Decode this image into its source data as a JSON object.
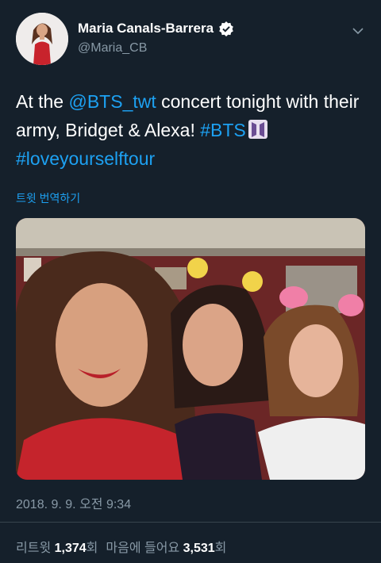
{
  "author": {
    "display_name": "Maria Canals-Barrera",
    "handle": "@Maria_CB",
    "verified": true
  },
  "tweet": {
    "text_1": "At the ",
    "mention": "@BTS_twt",
    "text_2": " concert tonight with their army, Bridget & Alexa!  ",
    "hashtag_1": "#BTS",
    "hashtag_2": "#loveyourselftour"
  },
  "translate_label": "트윗 번역하기",
  "timestamp": "2018. 9. 9. 오전 9:34",
  "stats": {
    "retweets_label": "리트윗",
    "retweets_count": "1,374",
    "retweets_unit": "회",
    "likes_label": "마음에 들어요",
    "likes_count": "3,531",
    "likes_unit": "회"
  },
  "colors": {
    "background": "#15202b",
    "link": "#1da1f2",
    "secondary_text": "#8899a6",
    "divider": "#38444d"
  },
  "icons": {
    "verified": "verified-badge-icon",
    "chevron": "chevron-down-icon"
  }
}
